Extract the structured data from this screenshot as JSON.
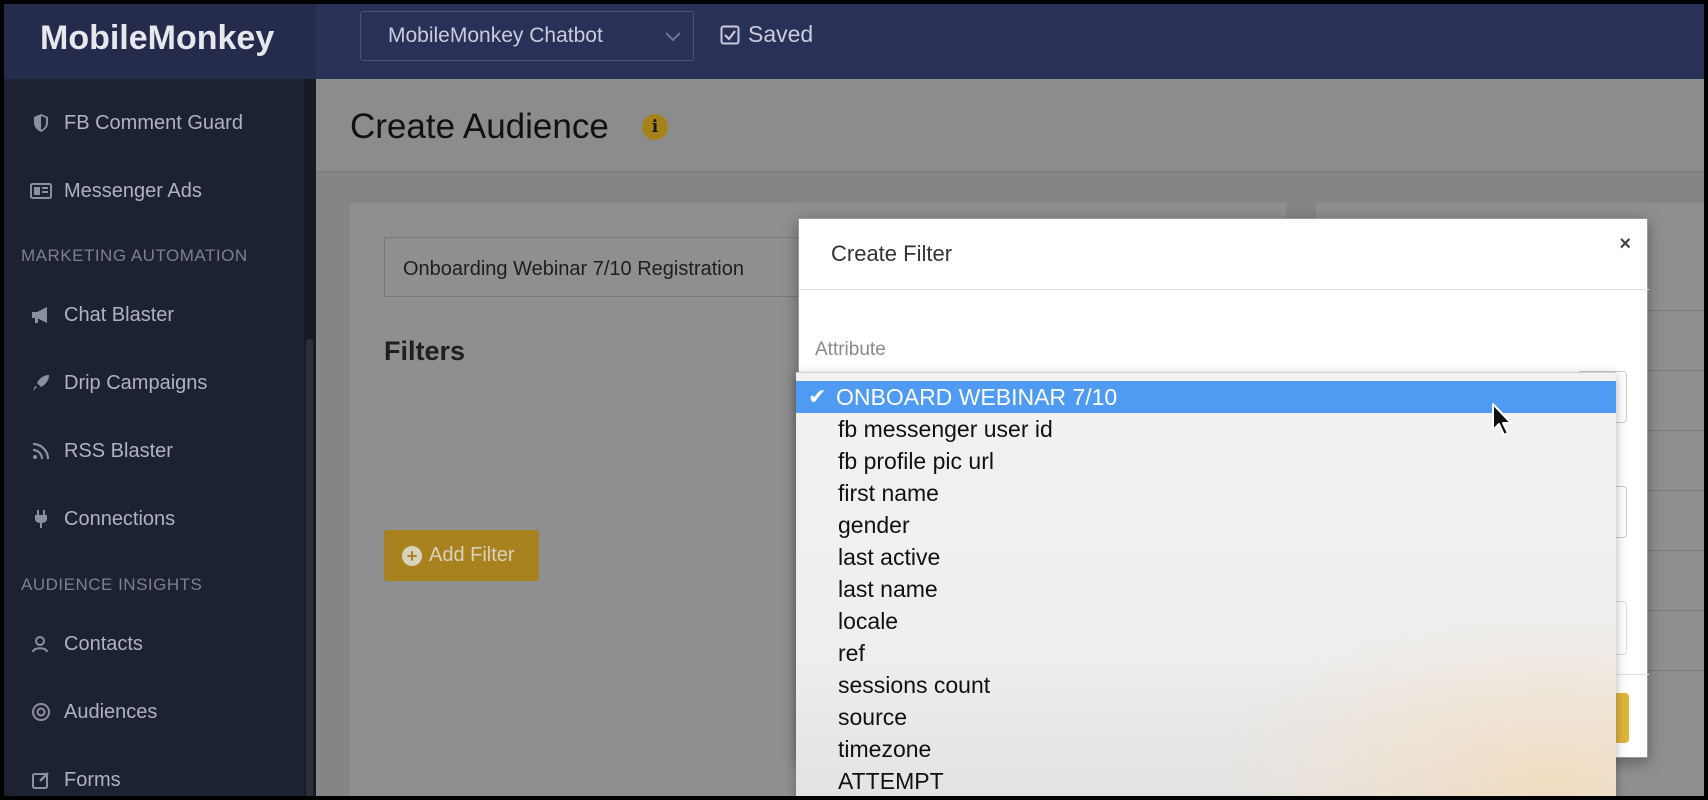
{
  "app": {
    "brand": "MobileMonkey"
  },
  "topbar": {
    "bot_select": "MobileMonkey Chatbot",
    "saved_label": "Saved"
  },
  "sidebar": {
    "items_top": [
      {
        "label": "FB Comment Guard",
        "icon": "shield-icon"
      },
      {
        "label": "Messenger Ads",
        "icon": "ad-icon"
      }
    ],
    "section1": "MARKETING AUTOMATION",
    "items_mid": [
      {
        "label": "Chat Blaster",
        "icon": "megaphone-icon"
      },
      {
        "label": "Drip Campaigns",
        "icon": "rocket-icon"
      },
      {
        "label": "RSS Blaster",
        "icon": "rss-icon"
      },
      {
        "label": "Connections",
        "icon": "plug-icon"
      }
    ],
    "section2": "AUDIENCE INSIGHTS",
    "items_bottom": [
      {
        "label": "Contacts",
        "icon": "contacts-icon"
      },
      {
        "label": "Audiences",
        "icon": "target-icon"
      },
      {
        "label": "Forms",
        "icon": "edit-icon"
      }
    ]
  },
  "page": {
    "title": "Create Audience",
    "audience_name": "Onboarding Webinar 7/10 Registration",
    "filters_title": "Filters",
    "add_filter": "Add Filter"
  },
  "modal": {
    "title": "Create Filter",
    "close": "×",
    "attribute_label": "Attribute"
  },
  "dropdown": {
    "selected": "ONBOARD WEBINAR 7/10",
    "options": [
      "ONBOARD WEBINAR 7/10",
      "fb messenger user id",
      "fb profile pic url",
      "first name",
      "gender",
      "last active",
      "last name",
      "locale",
      "ref",
      "sessions count",
      "source",
      "timezone",
      "ATTEMPT"
    ]
  },
  "colors": {
    "topbar": "#2a3158",
    "sidebar": "#1d2230",
    "accent": "#e0b43a",
    "selected_option": "#4f9af3"
  }
}
